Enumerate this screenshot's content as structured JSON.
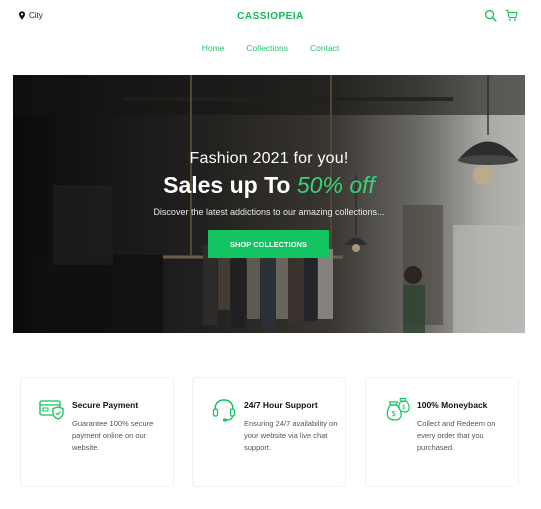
{
  "header": {
    "location_label": "City",
    "brand": "CASSIOPEIA",
    "search_icon": "search-icon",
    "cart_icon": "cart-icon"
  },
  "nav": {
    "items": [
      "Home",
      "Collections",
      "Contact"
    ]
  },
  "hero": {
    "small_title": "Fashion 2021 for you!",
    "big_title_prefix": "Sales up To",
    "big_title_accent": "50% off",
    "subtitle": "Discover the latest addictions to our amazing collections...",
    "cta_label": "SHOP COLLECTIONS"
  },
  "features": [
    {
      "icon": "card-shield-icon",
      "title": "Secure Payment",
      "desc": "Guarantee 100% secure payment online on our website."
    },
    {
      "icon": "headset-icon",
      "title": "24/7 Hour Support",
      "desc": "Ensuring 24/7 availability on your website via live chat support."
    },
    {
      "icon": "money-bag-icon",
      "title": "100% Moneyback",
      "desc": "Collect and Redeem on every order that you purchased."
    }
  ],
  "colors": {
    "accent": "#12c462",
    "brand_text": "#10b95f"
  }
}
